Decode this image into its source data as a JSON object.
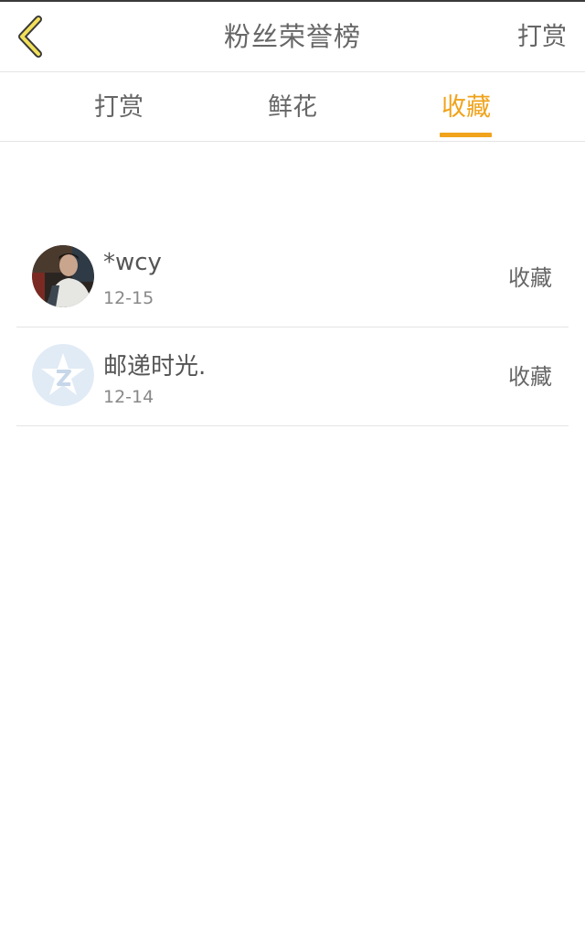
{
  "header": {
    "title": "粉丝荣誉榜",
    "action_label": "打赏",
    "back_icon": "chevron-left-icon",
    "accent_color": "#f0a31b"
  },
  "tabs": [
    {
      "label": "打赏",
      "active": false
    },
    {
      "label": "鲜花",
      "active": false
    },
    {
      "label": "收藏",
      "active": true
    }
  ],
  "list": {
    "items": [
      {
        "name": "*wcy",
        "date": "12-15",
        "action": "收藏",
        "avatar": "user-photo"
      },
      {
        "name": "邮递时光.",
        "date": "12-14",
        "action": "收藏",
        "avatar": "default-star-avatar-icon"
      }
    ]
  }
}
